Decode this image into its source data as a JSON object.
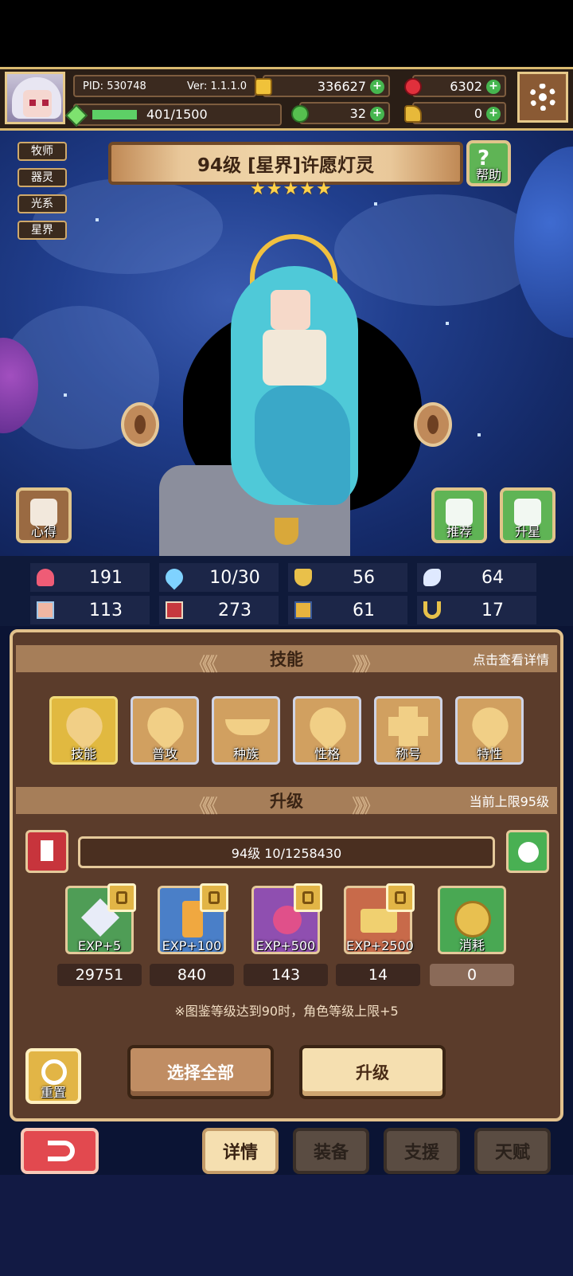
{
  "topbar": {
    "pid": "PID: 530748",
    "version": "Ver: 1.1.1.0",
    "stamina": "401/1500",
    "gold": "336627",
    "ruby": "6302",
    "clover": "32",
    "key": "0"
  },
  "tags": [
    "牧师",
    "器灵",
    "光系",
    "星界"
  ],
  "hero": {
    "title": "94级  [星界]许愿灯灵",
    "stars": 5,
    "help_label": "帮助",
    "insight_label": "心得",
    "recommend_label": "推荐",
    "starup_label": "升星"
  },
  "stats": [
    {
      "icon": "heart-icon",
      "value": "191"
    },
    {
      "icon": "water-drop-icon",
      "value": "10/30"
    },
    {
      "icon": "shield-icon",
      "value": "56"
    },
    {
      "icon": "wing-icon",
      "value": "64"
    },
    {
      "icon": "fist-icon",
      "value": "113"
    },
    {
      "icon": "book-icon",
      "value": "273"
    },
    {
      "icon": "boot-icon",
      "value": "61"
    },
    {
      "icon": "magnet-icon",
      "value": "17"
    }
  ],
  "skills": {
    "header": "技能",
    "hint": "点击查看详情",
    "items": [
      "技能",
      "普攻",
      "种族",
      "性格",
      "称号",
      "特性"
    ]
  },
  "upgrade": {
    "header": "升级",
    "hint": "当前上限95级",
    "level_progress": "94级  10/1258430",
    "items": [
      {
        "label": "EXP+5",
        "qty": "29751"
      },
      {
        "label": "EXP+100",
        "qty": "840"
      },
      {
        "label": "EXP+500",
        "qty": "143"
      },
      {
        "label": "EXP+2500",
        "qty": "14"
      },
      {
        "label": "消耗",
        "qty": "0"
      }
    ],
    "note": "※图鉴等级达到90时，角色等级上限+5",
    "reset_label": "重置",
    "select_all_label": "选择全部",
    "upgrade_label": "升级"
  },
  "tabs": [
    "详情",
    "装备",
    "支援",
    "天赋"
  ],
  "colors": {
    "panel": "#5b3c2b",
    "accent_gold": "#e2b546",
    "green": "#49b053",
    "red": "#e2494f"
  }
}
